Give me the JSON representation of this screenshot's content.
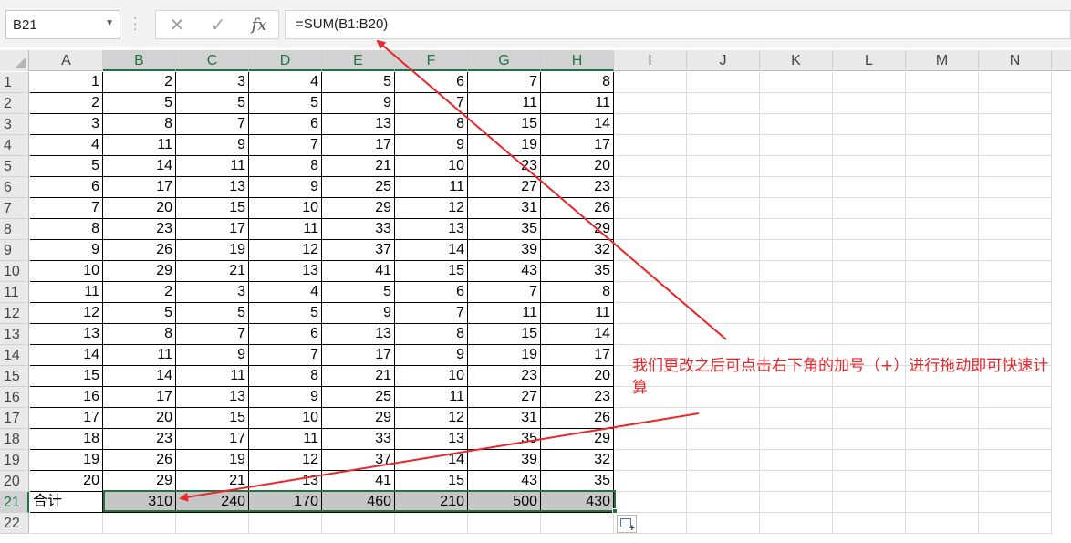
{
  "formula_bar": {
    "name_box": "B21",
    "cancel_icon": "close-icon",
    "enter_icon": "check-icon",
    "fx_label": "fx",
    "formula": "=SUM(B1:B20)"
  },
  "columns": [
    "A",
    "B",
    "C",
    "D",
    "E",
    "F",
    "G",
    "H",
    "I",
    "J",
    "K",
    "L",
    "M",
    "N"
  ],
  "rows": [
    [
      1,
      2,
      3,
      4,
      5,
      6,
      7,
      8
    ],
    [
      2,
      5,
      5,
      5,
      9,
      7,
      11,
      11
    ],
    [
      3,
      8,
      7,
      6,
      13,
      8,
      15,
      14
    ],
    [
      4,
      11,
      9,
      7,
      17,
      9,
      19,
      17
    ],
    [
      5,
      14,
      11,
      8,
      21,
      10,
      23,
      20
    ],
    [
      6,
      17,
      13,
      9,
      25,
      11,
      27,
      23
    ],
    [
      7,
      20,
      15,
      10,
      29,
      12,
      31,
      26
    ],
    [
      8,
      23,
      17,
      11,
      33,
      13,
      35,
      29
    ],
    [
      9,
      26,
      19,
      12,
      37,
      14,
      39,
      32
    ],
    [
      10,
      29,
      21,
      13,
      41,
      15,
      43,
      35
    ],
    [
      11,
      2,
      3,
      4,
      5,
      6,
      7,
      8
    ],
    [
      12,
      5,
      5,
      5,
      9,
      7,
      11,
      11
    ],
    [
      13,
      8,
      7,
      6,
      13,
      8,
      15,
      14
    ],
    [
      14,
      11,
      9,
      7,
      17,
      9,
      19,
      17
    ],
    [
      15,
      14,
      11,
      8,
      21,
      10,
      23,
      20
    ],
    [
      16,
      17,
      13,
      9,
      25,
      11,
      27,
      23
    ],
    [
      17,
      20,
      15,
      10,
      29,
      12,
      31,
      26
    ],
    [
      18,
      23,
      17,
      11,
      33,
      13,
      35,
      29
    ],
    [
      19,
      26,
      19,
      12,
      37,
      14,
      39,
      32
    ],
    [
      20,
      29,
      21,
      13,
      41,
      15,
      43,
      35
    ]
  ],
  "total_row": {
    "label": "合计",
    "values": [
      310,
      240,
      170,
      460,
      210,
      500,
      430
    ]
  },
  "annotation": "我们更改之后可点击右下角的加号（+）进行拖动即可快速计算",
  "colors": {
    "accent": "#217346",
    "annotation": "#e8262b",
    "total_fill": "#c6c6c6"
  }
}
